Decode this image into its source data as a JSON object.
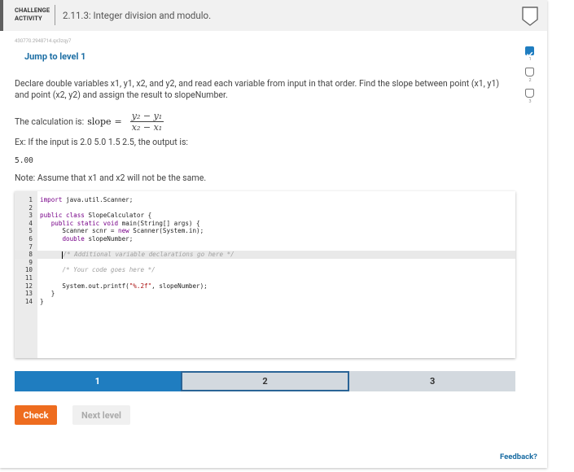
{
  "header": {
    "label_line1": "CHALLENGE",
    "label_line2": "ACTIVITY",
    "title": "2.11.3: Integer division and modulo."
  },
  "content_id": "430770.2948714.qx3zqy7",
  "jump_link": "Jump to level 1",
  "prompt": "Declare double variables x1, y1, x2, and y2, and read each variable from input in that order. Find the slope between point (x1, y1) and point (x2, y2) and assign the result to slopeNumber.",
  "calc": {
    "label": "The calculation is:",
    "lhs": "slope",
    "eq": "=",
    "numerator": "y₂ − y₁",
    "denominator": "x₂ − x₁"
  },
  "example": "Ex: If the input is 2.0 5.0 1.5 2.5, the output is:",
  "output": "5.00",
  "note": "Note: Assume that x1 and x2 will not be the same.",
  "code_lines": [
    {
      "n": "1",
      "text": "import java.util.Scanner;"
    },
    {
      "n": "2",
      "text": ""
    },
    {
      "n": "3",
      "text": "public class SlopeCalculator {"
    },
    {
      "n": "4",
      "text": "   public static void main(String[] args) {"
    },
    {
      "n": "5",
      "text": "      Scanner scnr = new Scanner(System.in);"
    },
    {
      "n": "6",
      "text": "      double slopeNumber;"
    },
    {
      "n": "7",
      "text": ""
    },
    {
      "n": "8",
      "text": "      /* Additional variable declarations go here */"
    },
    {
      "n": "9",
      "text": ""
    },
    {
      "n": "10",
      "text": "      /* Your code goes here */"
    },
    {
      "n": "11",
      "text": ""
    },
    {
      "n": "12",
      "text": "      System.out.printf(\"%.2f\", slopeNumber);"
    },
    {
      "n": "13",
      "text": "   }"
    },
    {
      "n": "14",
      "text": "}"
    }
  ],
  "levels": [
    "1",
    "2",
    "3"
  ],
  "buttons": {
    "check": "Check",
    "next": "Next level"
  },
  "feedback": "Feedback?",
  "sidebar_levels": [
    {
      "num": "1",
      "done": true
    },
    {
      "num": "2",
      "done": false
    },
    {
      "num": "3",
      "done": false
    }
  ],
  "colors": {
    "accent": "#1f7dc0",
    "check_button": "#ee6c1f",
    "link": "#1c6ea4"
  }
}
